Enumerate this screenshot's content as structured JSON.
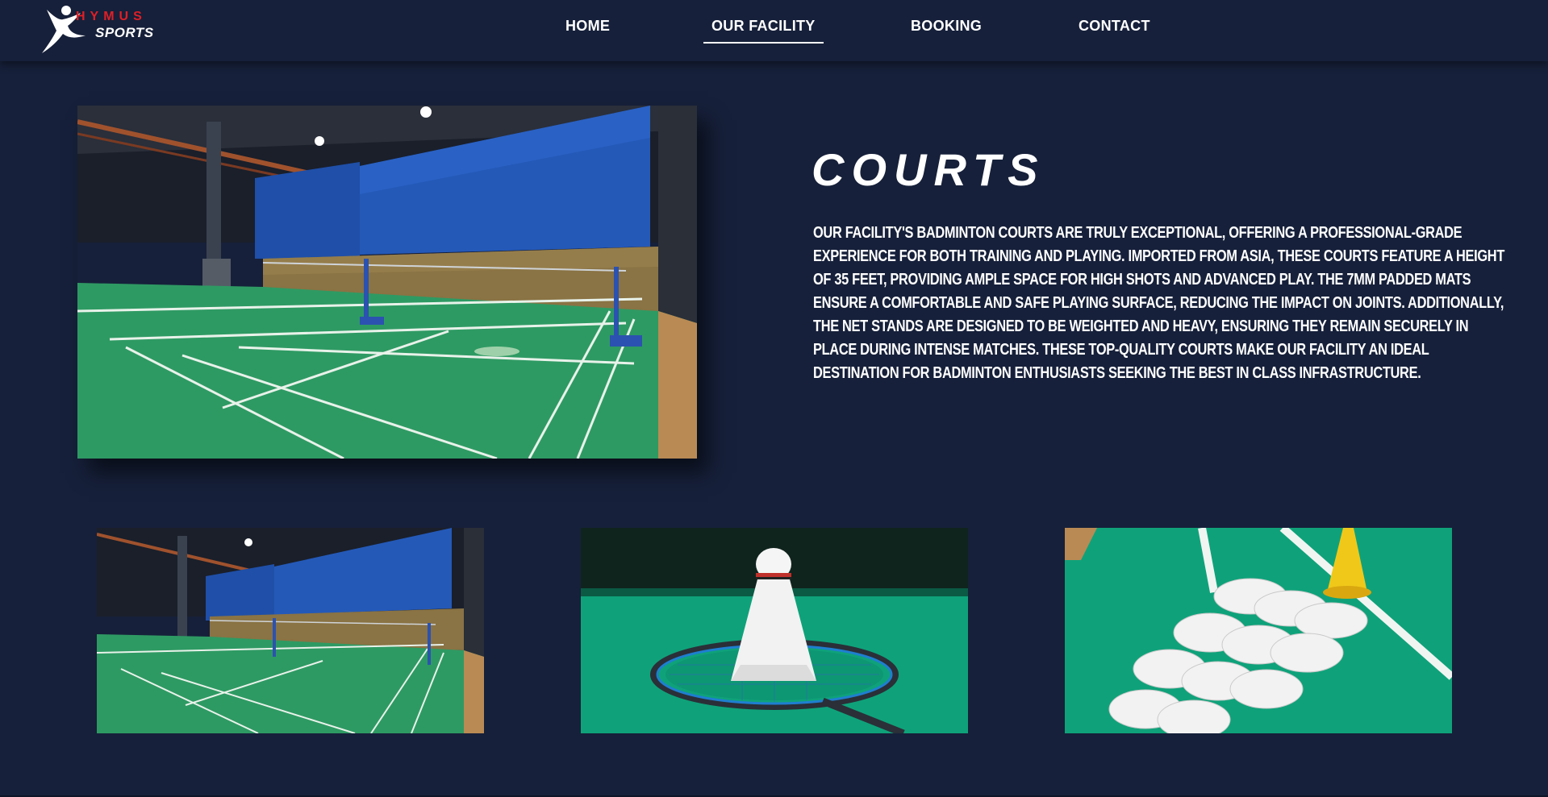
{
  "brand": {
    "logo_top": "HYMUS",
    "logo_bottom": "SPORTS"
  },
  "nav": {
    "items": [
      {
        "label": "HOME"
      },
      {
        "label": "OUR FACILITY"
      },
      {
        "label": "BOOKING"
      },
      {
        "label": "CONTACT"
      }
    ],
    "active": "OUR FACILITY"
  },
  "section": {
    "title": "COURTS",
    "description": "OUR FACILITY'S BADMINTON COURTS ARE TRULY EXCEPTIONAL, OFFERING A PROFESSIONAL-GRADE EXPERIENCE FOR BOTH TRAINING AND PLAYING. IMPORTED FROM ASIA, THESE COURTS FEATURE A HEIGHT OF 35 FEET, PROVIDING AMPLE SPACE FOR HIGH SHOTS AND ADVANCED PLAY. THE 7MM PADDED MATS ENSURE A COMFORTABLE AND SAFE PLAYING SURFACE, REDUCING THE IMPACT ON JOINTS. ADDITIONALLY, THE NET STANDS ARE DESIGNED TO BE WEIGHTED AND HEAVY, ENSURING THEY REMAIN SECURELY IN PLACE DURING INTENSE MATCHES. THESE TOP-QUALITY COURTS MAKE OUR FACILITY AN IDEAL DESTINATION FOR BADMINTON ENTHUSIASTS SEEKING THE BEST IN CLASS INFRASTRUCTURE."
  },
  "colors": {
    "background": "#16203a",
    "accent_red": "#e01f26",
    "court_green": "#2e9a63",
    "curtain_blue": "#1f4fa8"
  },
  "gallery": [
    {
      "subject": "indoor badminton court hall"
    },
    {
      "subject": "shuttlecock on racket"
    },
    {
      "subject": "row of shuttlecocks on court"
    }
  ]
}
